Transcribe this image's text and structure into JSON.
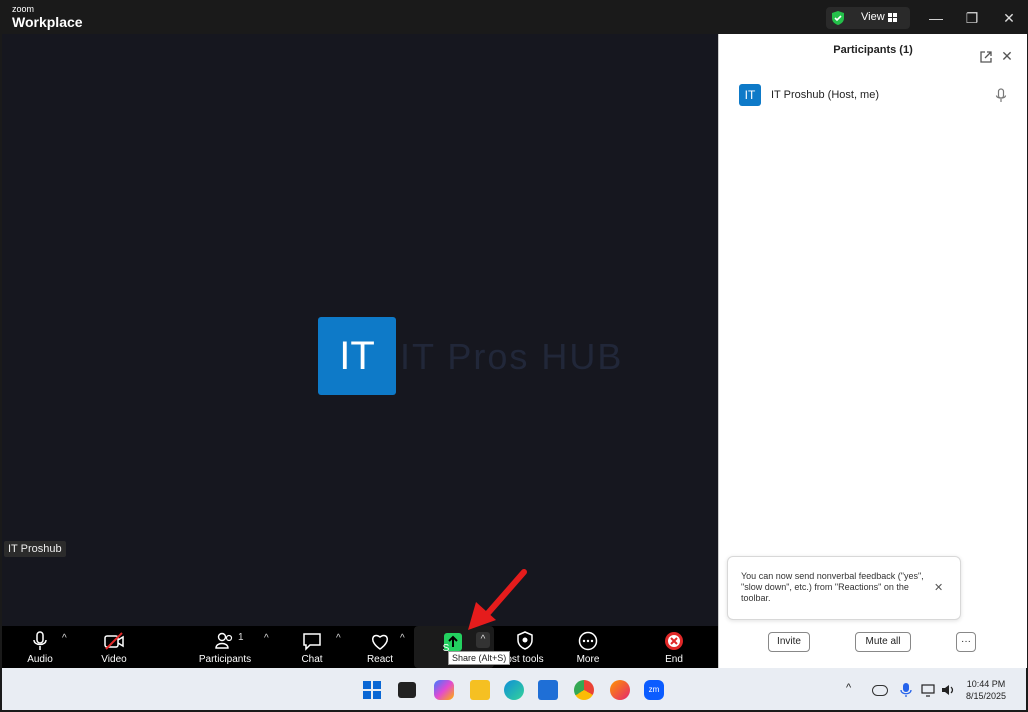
{
  "titlebar": {
    "brand_top": "zoom",
    "brand_bottom": "Workplace",
    "view_label": "View",
    "controls": {
      "minimize": "—",
      "restore": "❐",
      "close": "✕"
    }
  },
  "video": {
    "avatar_initials": "IT",
    "watermark": "IT Pros HUB",
    "name_tag": "IT Proshub"
  },
  "participants_panel": {
    "title": "Participants (1)",
    "participants": [
      {
        "initials": "IT",
        "name": "IT Proshub (Host, me)"
      }
    ],
    "toast_text": "You can now send nonverbal feedback (\"yes\", \"slow down\", etc.) from \"Reactions\" on the toolbar.",
    "invite_label": "Invite",
    "mute_all_label": "Mute all",
    "more_label": "···"
  },
  "toolbar": {
    "audio": "Audio",
    "video": "Video",
    "participants": "Participants",
    "participants_count": "1",
    "chat": "Chat",
    "react": "React",
    "share": "S",
    "share_tooltip": "Share (Alt+S)",
    "host_tools": "ost tools",
    "more": "More",
    "end": "End"
  },
  "taskbar": {
    "time": "10:44 PM",
    "date": "8/15/2025"
  },
  "colors": {
    "zoom_blue": "#0e7ac8",
    "share_green": "#23d160",
    "end_red": "#e02828",
    "arrow_red": "#e51c1c"
  }
}
